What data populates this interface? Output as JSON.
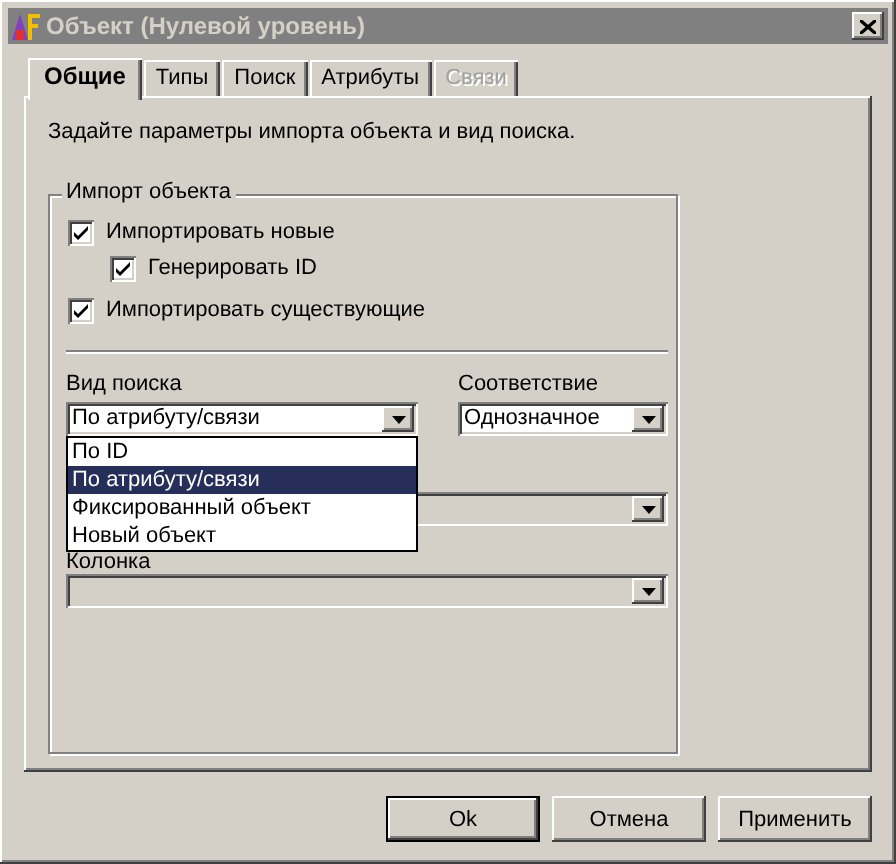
{
  "window": {
    "title": "Объект (Нулевой уровень)"
  },
  "tabs": [
    {
      "label": "Общие",
      "selected": true,
      "disabled": false
    },
    {
      "label": "Типы",
      "selected": false,
      "disabled": false
    },
    {
      "label": "Поиск",
      "selected": false,
      "disabled": false
    },
    {
      "label": "Атрибуты",
      "selected": false,
      "disabled": false
    },
    {
      "label": "Связи",
      "selected": false,
      "disabled": true
    }
  ],
  "description": "Задайте параметры импорта объекта и вид поиска.",
  "import_group": {
    "title": "Импорт объекта",
    "options": [
      {
        "label": "Импортировать новые",
        "checked": true,
        "children": [
          {
            "label": "Генерировать ID",
            "checked": true
          }
        ]
      },
      {
        "label": "Импортировать существующие",
        "checked": true
      }
    ]
  },
  "search_type": {
    "label": "Вид поиска",
    "value": "По атрибуту/связи",
    "expanded": true,
    "disabled": false,
    "options": [
      {
        "label": "По ID",
        "selected": false
      },
      {
        "label": "По атрибуту/связи",
        "selected": true
      },
      {
        "label": "Фиксированный объект",
        "selected": false
      },
      {
        "label": "Новый объект",
        "selected": false
      }
    ]
  },
  "match": {
    "label": "Соответствие",
    "value": "Однозначное",
    "disabled": false
  },
  "combo_3": {
    "disabled": true
  },
  "column": {
    "label": "Колонка",
    "disabled": true
  },
  "buttons": [
    {
      "label": "Ok",
      "default": true
    },
    {
      "label": "Отмена",
      "default": false
    },
    {
      "label": "Применить",
      "default": false
    }
  ]
}
